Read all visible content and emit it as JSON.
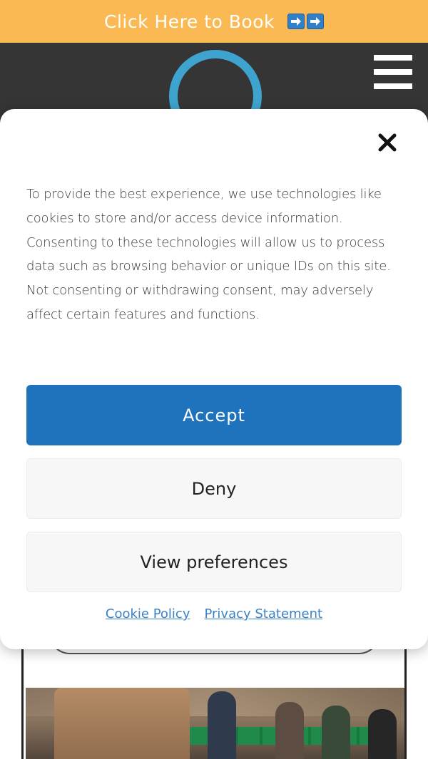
{
  "banner": {
    "label": "Click Here to Book",
    "icons": [
      "right-arrow-emoji",
      "right-arrow-emoji"
    ],
    "background": "#fbb954"
  },
  "header": {
    "background": "#353535",
    "menu_icon": "hamburger-menu-icon",
    "logo_accent": "#3ea4cf"
  },
  "cookie_banner": {
    "close_icon": "close-icon",
    "message": "To provide the best experience, we use technologies like cookies to store and/or access device information. Consenting to these technologies will allow us to process data such as browsing behavior or unique IDs on this site. Not consenting or withdrawing consent, may adversely affect certain features and functions.",
    "accept_label": "Accept",
    "deny_label": "Deny",
    "preferences_label": "View preferences",
    "links": {
      "cookie_policy": "Cookie Policy",
      "privacy_statement": "Privacy Statement"
    },
    "accent_color": "#1f72bc"
  }
}
